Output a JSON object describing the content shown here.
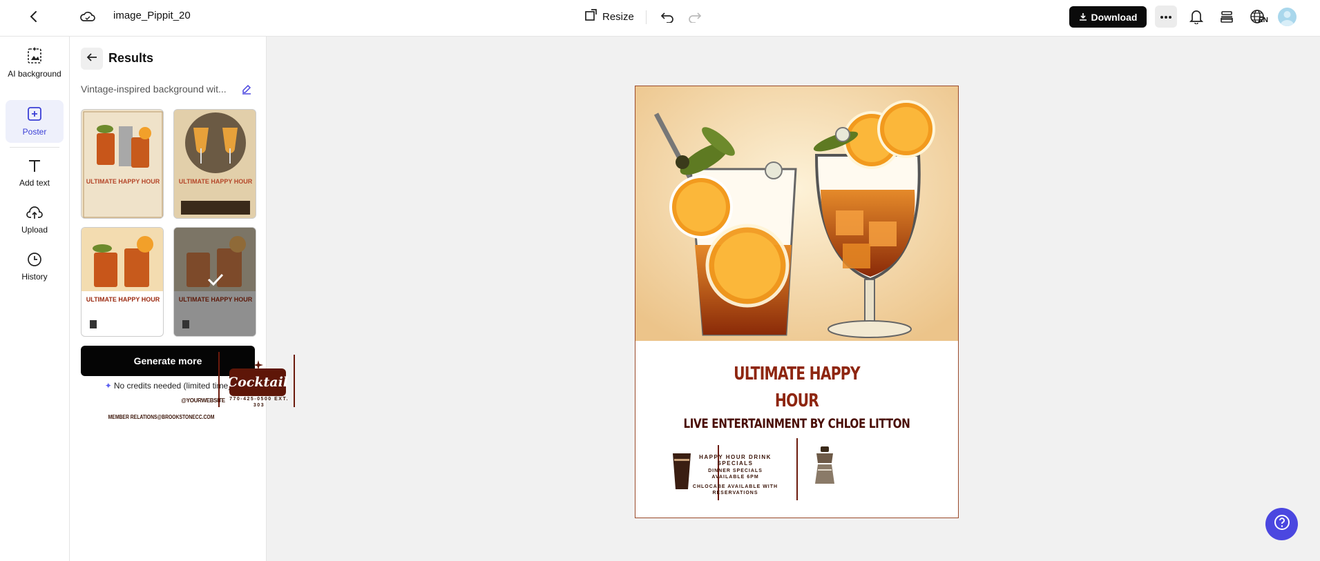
{
  "topbar": {
    "file_name": "image_Pippit_20",
    "resize_label": "Resize",
    "download_label": "Download",
    "lang": "EN"
  },
  "rail": {
    "items": [
      {
        "label": "AI background",
        "icon": "ai-background-icon"
      },
      {
        "label": "Poster",
        "icon": "poster-icon",
        "active": true
      },
      {
        "label": "Add text",
        "icon": "text-icon"
      },
      {
        "label": "Upload",
        "icon": "upload-icon"
      },
      {
        "label": "History",
        "icon": "clock-icon"
      }
    ]
  },
  "panel": {
    "title": "Results",
    "prompt": "Vintage-inspired background wit...",
    "thumbnails": [
      {
        "name": "result-1",
        "title": "ULTIMATE HAPPY HOUR",
        "selected": false
      },
      {
        "name": "result-2",
        "title": "ULTIMATE HAPPY HOUR",
        "selected": false
      },
      {
        "name": "result-3",
        "title": "ULTIMATE HAPPY HOUR",
        "selected": false
      },
      {
        "name": "result-4",
        "title": "ULTIMATE HAPPY HOUR",
        "selected": true
      }
    ],
    "generate_label": "Generate more",
    "credits_note": "No credits needed (limited time)"
  },
  "poster": {
    "title_line1": "ULTIMATE HAPPY",
    "title_line2": "HOUR",
    "subtitle": "LIVE ENTERTAINMENT BY CHLOE LITTON",
    "col1_heading": "HAPPY HOUR DRINK SPECIALS",
    "col1_line2": "DINNER SPECIALS AVAILABLE 6PM",
    "col1_line3": "CHLOCABE AVAILABLE WITH RESERVATIONS",
    "col2_text": "@YOURWEBSITE",
    "col3_phone": "770-425-0500 EXT. 303",
    "logo_text": "Cocktail",
    "footer_email": "MEMBER RELATIONS@BROOKSTONECC.COM"
  },
  "colors": {
    "accent": "#4b47e0",
    "poster_title": "#8e2610",
    "primary_button": "#050505"
  }
}
